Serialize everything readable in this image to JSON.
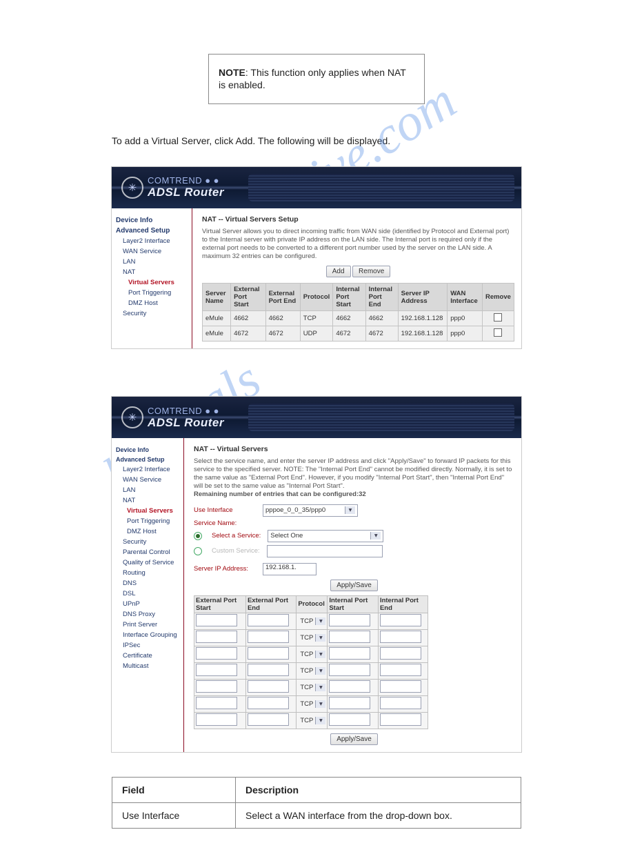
{
  "noteLabel": "NOTE",
  "noteText": ":  This function only applies when NAT is enabled.",
  "intro": "To add a Virtual Server, click Add.  The following will be displayed.",
  "shot1": {
    "title": "NAT -- Virtual Servers Setup",
    "desc": "Virtual Server allows you to direct incoming traffic from WAN side (identified by Protocol and External port) to the Internal server with private IP address on the LAN side. The Internal port is required only if the external port needs to be converted to a different port number used by the server on the LAN side. A maximum 32 entries can be configured.",
    "btnAdd": "Add",
    "btnRemove": "Remove",
    "headers": {
      "name": "Server Name",
      "eps": "External Port Start",
      "epe": "External Port End",
      "proto": "Protocol",
      "ips": "Internal Port Start",
      "ipe": "Internal Port End",
      "sip": "Server IP Address",
      "wan": "WAN Interface",
      "rem": "Remove"
    },
    "rows": [
      {
        "name": "eMule",
        "eps": "4662",
        "epe": "4662",
        "proto": "TCP",
        "ips": "4662",
        "ipe": "4662",
        "sip": "192.168.1.128",
        "wan": "ppp0"
      },
      {
        "name": "eMule",
        "eps": "4672",
        "epe": "4672",
        "proto": "UDP",
        "ips": "4672",
        "ipe": "4672",
        "sip": "192.168.1.128",
        "wan": "ppp0"
      }
    ],
    "sidebar": {
      "deviceInfo": "Device Info",
      "adv": "Advanced Setup",
      "l2": "Layer2 Interface",
      "wan": "WAN Service",
      "lan": "LAN",
      "nat": "NAT",
      "vs": "Virtual Servers",
      "pt": "Port Triggering",
      "dmz": "DMZ Host",
      "sec": "Security"
    }
  },
  "shot2": {
    "title": "NAT -- Virtual Servers",
    "desc": "Select the service name, and enter the server IP address and click \"Apply/Save\" to forward IP packets for this service to the specified server. NOTE: The \"Internal Port End\" cannot be modified directly. Normally, it is set to the same value as \"External Port End\". However, if you modify \"Internal Port Start\", then \"Internal Port End\" will be set to the same value as \"Internal Port Start\".",
    "remaining": "Remaining number of entries that can be configured:32",
    "useIf": "Use Interface",
    "useIfVal": "pppoe_0_0_35/ppp0",
    "svcName": "Service Name:",
    "selSvc": "Select a Service:",
    "selSvcVal": "Select One",
    "custSvc": "Custom Service:",
    "sip": "Server IP Address:",
    "sipVal": "192.168.1.",
    "apply": "Apply/Save",
    "h": {
      "eps": "External Port Start",
      "epe": "External Port End",
      "proto": "Protocol",
      "ips": "Internal Port Start",
      "ipe": "Internal Port End"
    },
    "protoVal": "TCP",
    "sidebar": {
      "deviceInfo": "Device Info",
      "adv": "Advanced Setup",
      "l2": "Layer2 Interface",
      "wan": "WAN Service",
      "lan": "LAN",
      "nat": "NAT",
      "vs": "Virtual Servers",
      "pt": "Port Triggering",
      "dmz": "DMZ Host",
      "sec": "Security",
      "pc": "Parental Control",
      "qos": "Quality of Service",
      "rt": "Routing",
      "dns": "DNS",
      "dsl": "DSL",
      "upnp": "UPnP",
      "dp": "DNS Proxy",
      "ps": "Print Server",
      "ig": "Interface Grouping",
      "ipsec": "IPSec",
      "cert": "Certificate",
      "mc": "Multicast"
    }
  },
  "fieldtable": {
    "c1": "Field",
    "c2": "Description",
    "r1a": "Use Interface",
    "r1b": "Select a WAN interface from the drop-down box."
  },
  "brand": {
    "name": "ADSL Router",
    "co": "COMTREND ● ●"
  }
}
